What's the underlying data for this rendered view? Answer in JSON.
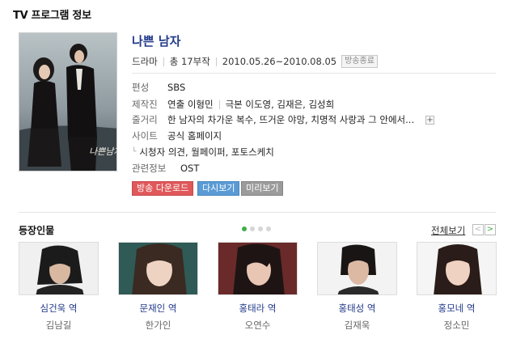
{
  "header": {
    "title": "TV 프로그램 정보"
  },
  "program": {
    "title": "나쁜 남자",
    "genre": "드라마",
    "episodes": "총 17부작",
    "period": "2010.05.26~2010.08.05",
    "status": "방송종료",
    "poster_text": "나쁜남자"
  },
  "info": {
    "channel_label": "편성",
    "channel": "SBS",
    "crew_label": "제작진",
    "director": "연출 이형민",
    "writer": "극본 이도영, 김재은, 김성희",
    "story_label": "줄거리",
    "story": "한 남자의 차가운 복수, 뜨거운 야망, 치명적 사랑과 그 안에서...",
    "site_label": "사이트",
    "site": "공식 홈페이지",
    "viewer_links": "시청자 의견, 월페이퍼, 포토스케치",
    "related_label": "관련정보",
    "related": "OST"
  },
  "buttons": {
    "download": "방송 다운로드",
    "replay": "다시보기",
    "preview": "미리보기"
  },
  "cast_section": {
    "title": "등장인물",
    "all_label": "전체보기",
    "prev": "<",
    "next": ">",
    "cast": [
      {
        "role": "심건욱 역",
        "actor": "김남길"
      },
      {
        "role": "문재인 역",
        "actor": "한가인"
      },
      {
        "role": "홍태라 역",
        "actor": "오연수"
      },
      {
        "role": "홍태성 역",
        "actor": "김재욱"
      },
      {
        "role": "홍모네 역",
        "actor": "정소민"
      }
    ]
  },
  "colors": {
    "download": "#e0585a",
    "replay": "#5a9bd5",
    "preview": "#9b9b9b",
    "accent_dot": "#3fae49",
    "title": "#223a8a"
  }
}
